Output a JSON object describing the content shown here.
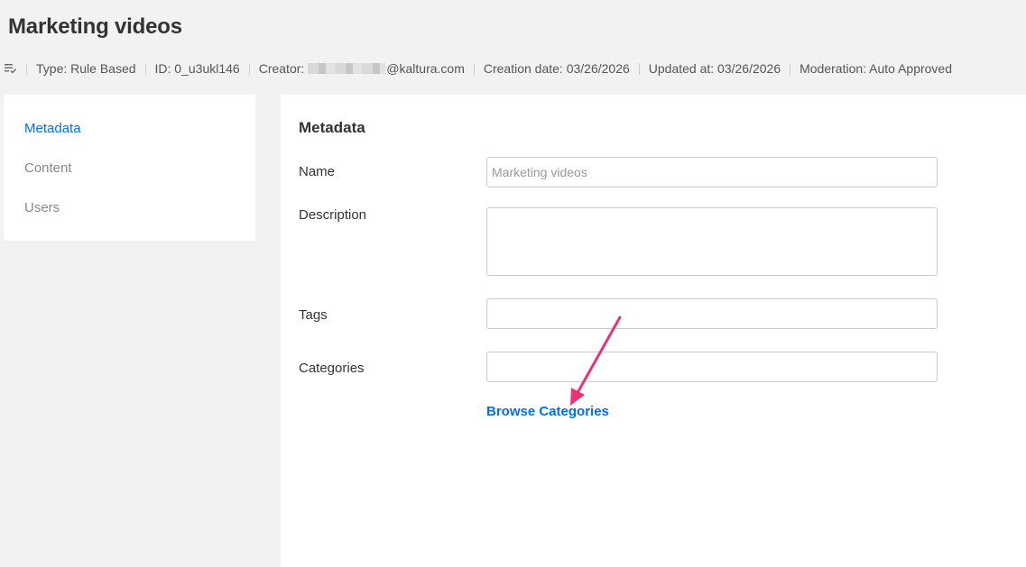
{
  "header": {
    "title": "Marketing videos"
  },
  "meta": {
    "type": "Type: Rule Based",
    "id": "ID: 0_u3ukl146",
    "creator_label": "Creator:",
    "creator_domain": "@kaltura.com",
    "creation_date": "Creation date: 03/26/2026",
    "updated_at": "Updated at: 03/26/2026",
    "moderation": "Moderation: Auto Approved"
  },
  "sidebar": {
    "items": [
      {
        "label": "Metadata",
        "active": true
      },
      {
        "label": "Content",
        "active": false
      },
      {
        "label": "Users",
        "active": false
      }
    ]
  },
  "form": {
    "title": "Metadata",
    "name_label": "Name",
    "name_value": "",
    "name_placeholder": "Marketing videos",
    "description_label": "Description",
    "description_value": "",
    "tags_label": "Tags",
    "tags_value": "",
    "categories_label": "Categories",
    "categories_value": "",
    "browse_label": "Browse Categories"
  },
  "colors": {
    "accent": "#006efa",
    "annotation_arrow": "#e8337a",
    "background": "#f2f2f2"
  },
  "icons": [
    "playlist-rule-icon"
  ]
}
